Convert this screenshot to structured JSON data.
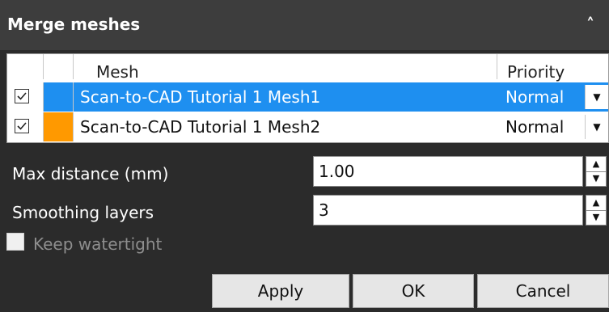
{
  "panel": {
    "title": "Merge meshes",
    "collapse_icon": "chevron-up-icon"
  },
  "table": {
    "columns": [
      "",
      "",
      "Mesh",
      "Priority"
    ],
    "rows": [
      {
        "checked": true,
        "color": "#1e8ff0",
        "mesh": "Scan-to-CAD Tutorial 1 Mesh1",
        "priority": "Normal",
        "selected": true
      },
      {
        "checked": true,
        "color": "#ff9900",
        "mesh": "Scan-to-CAD Tutorial 1 Mesh2",
        "priority": "Normal",
        "selected": false
      }
    ]
  },
  "fields": {
    "max_distance_label": "Max distance (mm)",
    "max_distance_value": "1.00",
    "smoothing_label": "Smoothing layers",
    "smoothing_value": "3"
  },
  "keep_watertight": {
    "label": "Keep watertight",
    "checked": false,
    "enabled": false
  },
  "buttons": {
    "apply": "Apply",
    "ok": "OK",
    "cancel": "Cancel"
  },
  "colors": {
    "selection": "#1e8ff0",
    "mesh2_color": "#ff9900",
    "panel_bg": "#2b2b2b",
    "title_bg": "#3d3d3d"
  }
}
